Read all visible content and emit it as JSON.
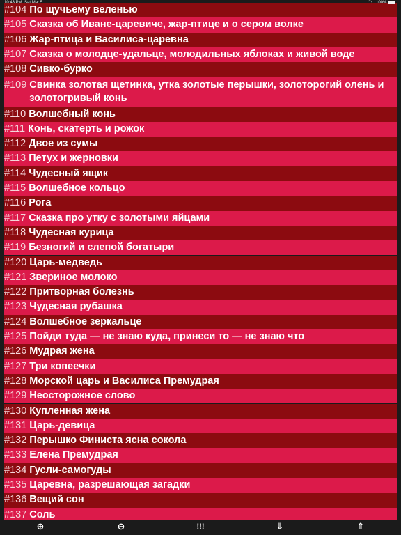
{
  "status": {
    "time": "10:43 PM",
    "date": "Sat Mar 5",
    "battery": "100%"
  },
  "list": {
    "items": [
      {
        "num": "#104",
        "title": "По щучьему веленью"
      },
      {
        "num": "#105",
        "title": "Сказка об Иване-царевиче, жар-птице и о сером волке"
      },
      {
        "num": "#106",
        "title": "Жар-птица и Василиса-царевна"
      },
      {
        "num": "#107",
        "title": "Сказка о молодце-удальце, молодильных яблоках и живой воде"
      },
      {
        "num": "#108",
        "title": "Сивко-бурко"
      },
      {
        "num": "#109",
        "title": "Свинка золотая щетинка, утка золотые перышки, золоторогий олень и золотогривый конь"
      },
      {
        "num": "#110",
        "title": "Волшебный конь"
      },
      {
        "num": "#111",
        "title": "Конь, скатерть и рожок"
      },
      {
        "num": "#112",
        "title": "Двое из сумы"
      },
      {
        "num": "#113",
        "title": "Петух и жерновки"
      },
      {
        "num": "#114",
        "title": "Чудесный ящик"
      },
      {
        "num": "#115",
        "title": "Волшебное кольцо"
      },
      {
        "num": "#116",
        "title": "Рога"
      },
      {
        "num": "#117",
        "title": "Сказка про утку с золотыми яйцами"
      },
      {
        "num": "#118",
        "title": "Чудесная курица"
      },
      {
        "num": "#119",
        "title": "Безногий и слепой богатыри"
      },
      {
        "num": "#120",
        "title": "Царь-медведь"
      },
      {
        "num": "#121",
        "title": "Звериное молоко"
      },
      {
        "num": "#122",
        "title": "Притворная болезнь"
      },
      {
        "num": "#123",
        "title": "Чудесная рубашка"
      },
      {
        "num": "#124",
        "title": "Волшебное зеркальце"
      },
      {
        "num": "#125",
        "title": "Пойди туда — не знаю куда, принеси то — не знаю что"
      },
      {
        "num": "#126",
        "title": "Мудрая жена"
      },
      {
        "num": "#127",
        "title": "Три копеечки"
      },
      {
        "num": "#128",
        "title": "Морской царь и Василиса Премудрая"
      },
      {
        "num": "#129",
        "title": "Неосторожное слово"
      },
      {
        "num": "#130",
        "title": "Купленная жена"
      },
      {
        "num": "#131",
        "title": "Царь-девица"
      },
      {
        "num": "#132",
        "title": "Перышко Финиста ясна сокола"
      },
      {
        "num": "#133",
        "title": "Елена Премудрая"
      },
      {
        "num": "#134",
        "title": "Гусли-самогуды"
      },
      {
        "num": "#135",
        "title": "Царевна, разрешающая загадки"
      },
      {
        "num": "#136",
        "title": "Вещий сон"
      },
      {
        "num": "#137",
        "title": "Соль"
      }
    ]
  },
  "toolbar": {
    "zoom_in": "⊕",
    "zoom_out": "⊖",
    "menu": "!!!",
    "scroll_down": "⇓",
    "scroll_up": "⇑"
  },
  "colors": {
    "row_dark": "#8c0b10",
    "row_light": "#dc1a4a",
    "bar_bg": "#1b1b1b"
  }
}
